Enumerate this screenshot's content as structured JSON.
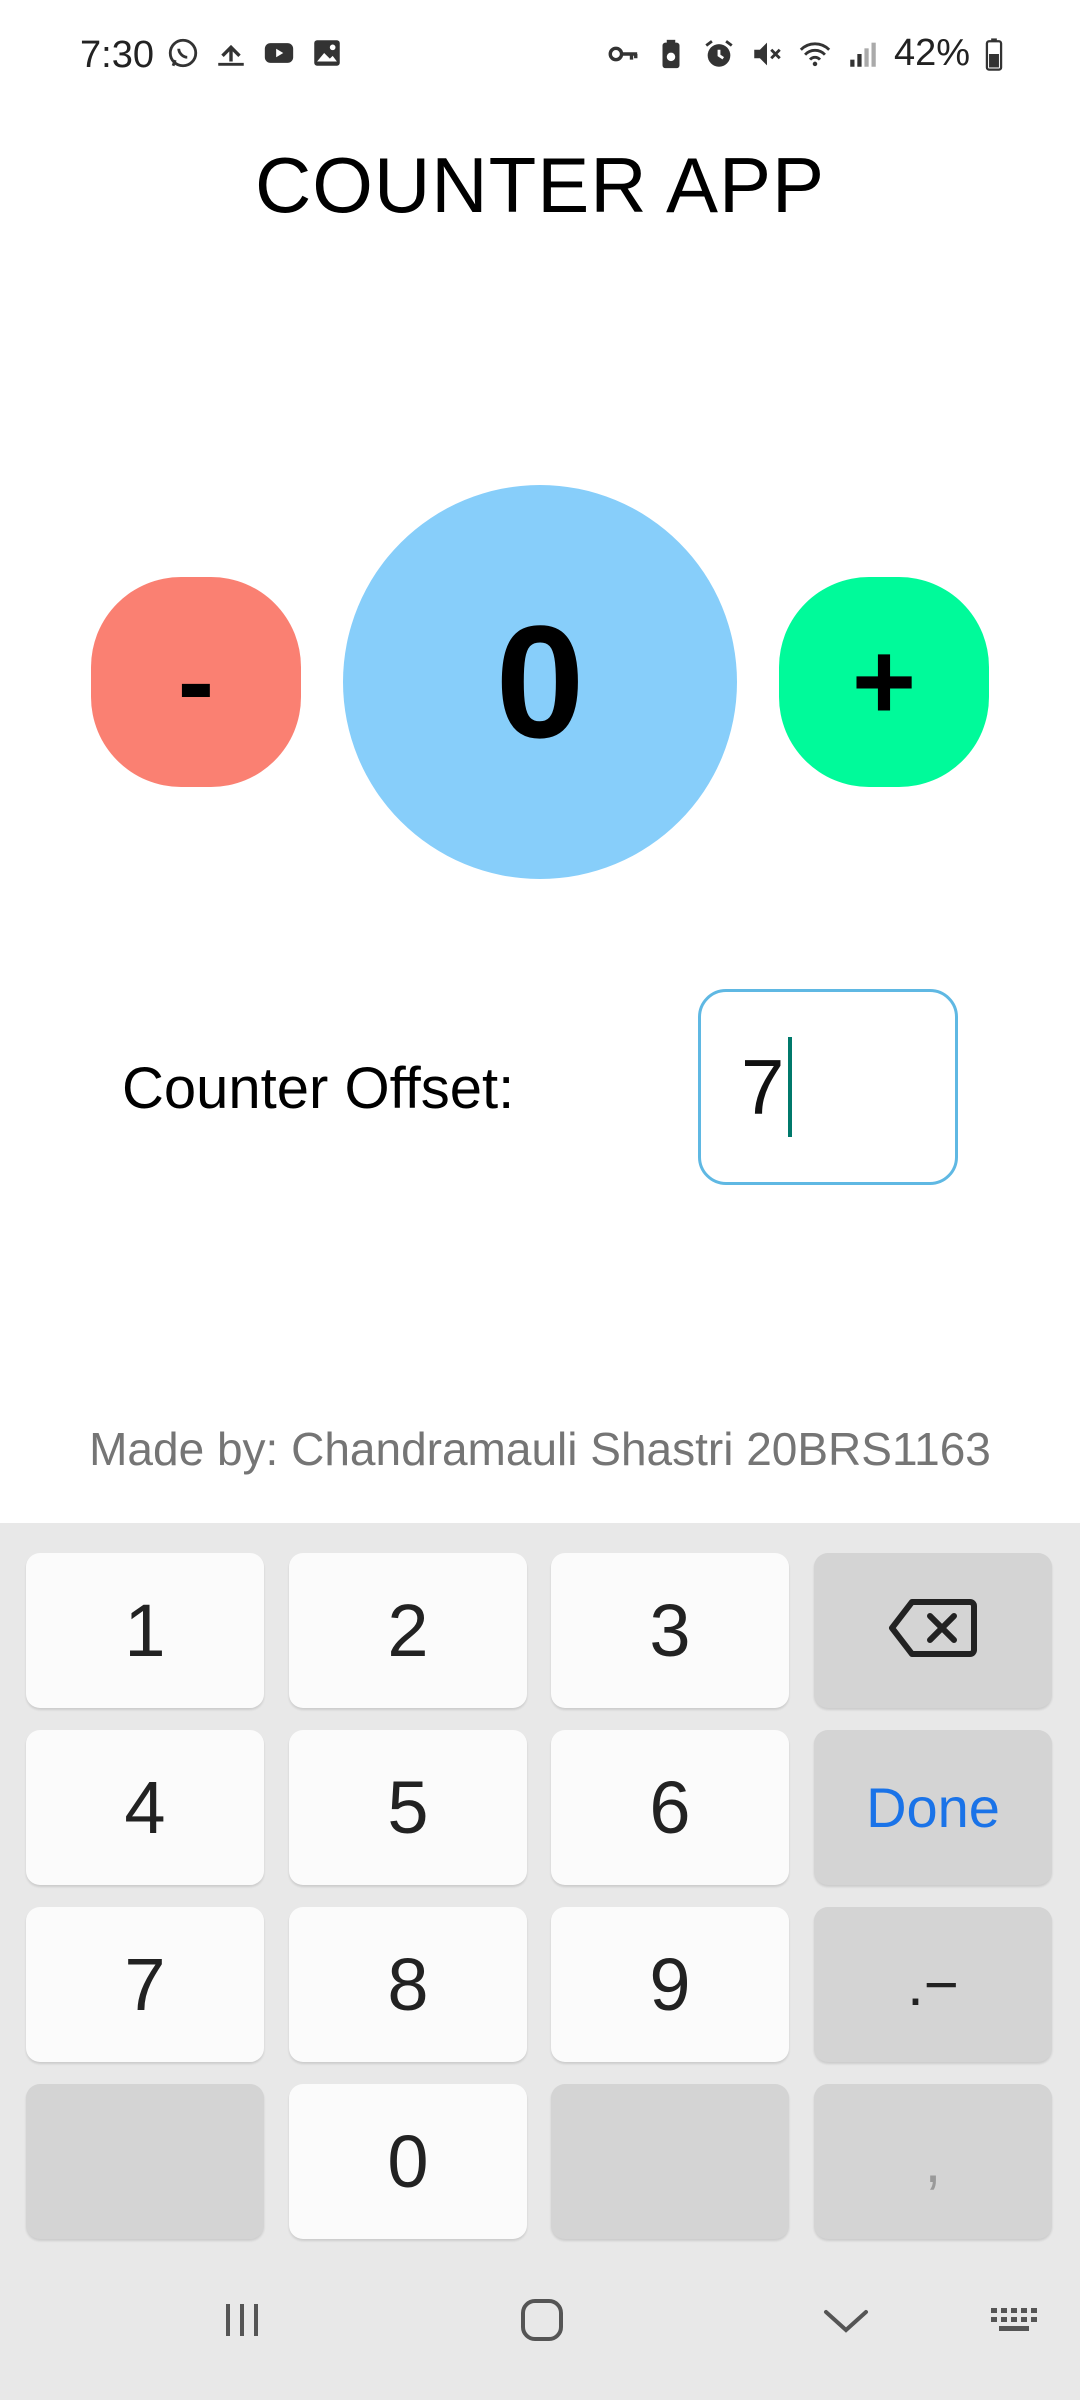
{
  "status_bar": {
    "time": "7:30",
    "battery": "42%",
    "left_icons": [
      "whatsapp-icon",
      "transfer-icon",
      "youtube-icon",
      "gallery-icon"
    ],
    "right_icons": [
      "vpn-key-icon",
      "battery-saver-icon",
      "alarm-icon",
      "mute-icon",
      "wifi-icon",
      "signal-icon",
      "battery-icon"
    ]
  },
  "app": {
    "title": "COUNTER APP",
    "decrement_label": "-",
    "increment_label": "+",
    "counter_value": "0",
    "offset_label": "Counter Offset:",
    "offset_value": "7",
    "made_by": "Made by: Chandramauli Shastri 20BRS1163"
  },
  "colors": {
    "decrement": "#fa8072",
    "increment": "#00fa9a",
    "counter": "#87cefa",
    "done": "#1a73e8"
  },
  "keyboard": {
    "keys": {
      "k1": "1",
      "k2": "2",
      "k3": "3",
      "k4": "4",
      "k5": "5",
      "k6": "6",
      "k7": "7",
      "k8": "8",
      "k9": "9",
      "k0": "0",
      "done": "Done",
      "symbols": ".−",
      "comma": ","
    },
    "backspace_icon": "backspace-icon"
  },
  "nav_bar": {
    "icons": [
      "recents-icon",
      "home-icon",
      "back-down-icon",
      "keyboard-switch-icon"
    ]
  }
}
